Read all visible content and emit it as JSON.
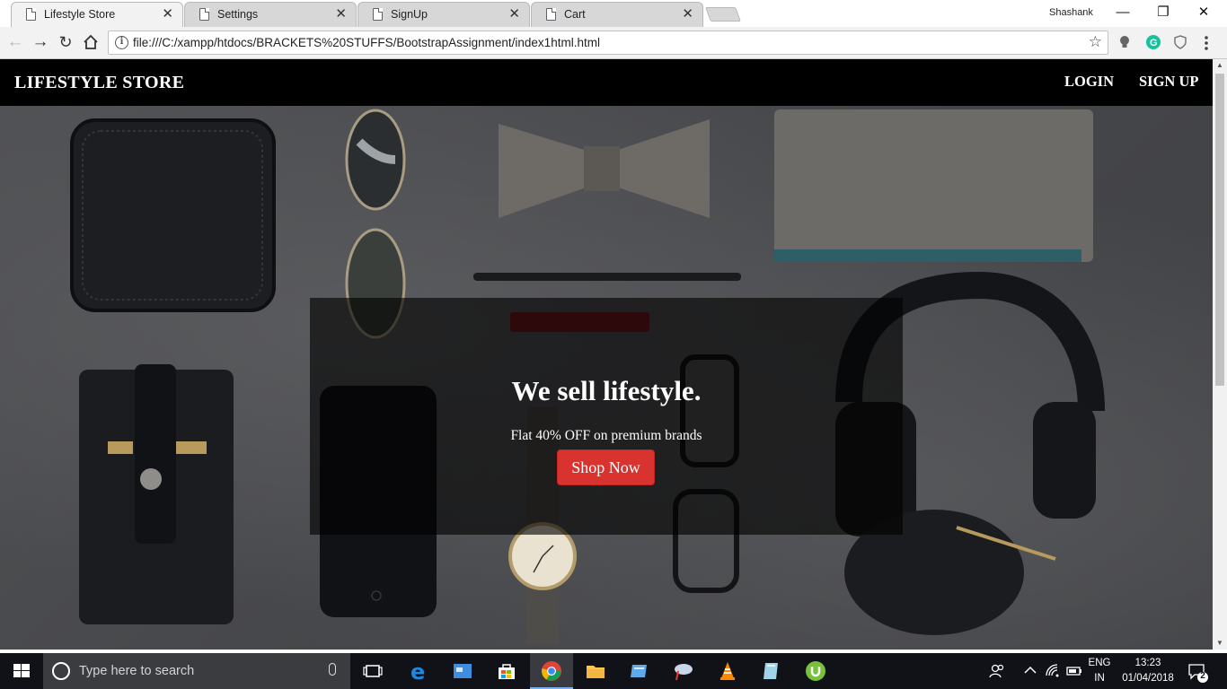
{
  "browser": {
    "tabs": [
      {
        "title": "Lifestyle Store",
        "active": true
      },
      {
        "title": "Settings",
        "active": false
      },
      {
        "title": "SignUp",
        "active": false
      },
      {
        "title": "Cart",
        "active": false
      }
    ],
    "tab_close_glyph": "✕",
    "profile": "Shashank",
    "url": "file:///C:/xampp/htdocs/BRACKETS%20STUFFS/BootstrapAssignment/index1html.html",
    "window_controls": {
      "minimize": "—",
      "restore": "❐",
      "close": "✕"
    }
  },
  "site": {
    "brand": "LIFESTYLE STORE",
    "nav": {
      "login": "LOGIN",
      "signup": "SIGN UP"
    },
    "hero": {
      "title": "We sell lifestyle.",
      "subtitle": "Flat 40% OFF on premium brands",
      "button": "Shop Now"
    }
  },
  "taskbar": {
    "search_placeholder": "Type here to search",
    "language": "ENG",
    "region": "IN",
    "time": "13:23",
    "date": "01/04/2018",
    "notifications": "2"
  },
  "colors": {
    "navbar": "#000000",
    "cta": "#d9332f",
    "overlay": "rgba(0,0,0,0.62)",
    "taskbar": "#101218"
  },
  "icons": [
    "file-icon",
    "back-icon",
    "forward-icon",
    "reload-icon",
    "home-icon",
    "info-icon",
    "bookmark-star-icon",
    "bulb-extension-icon",
    "grammarly-icon",
    "shield-extension-icon",
    "menu-icon",
    "windows-start-icon",
    "cortana-icon",
    "microphone-icon",
    "task-view-icon",
    "edge-icon",
    "store-icon",
    "chrome-icon",
    "file-explorer-icon",
    "vlc-icon",
    "utorrent-icon",
    "people-icon",
    "wifi-icon",
    "battery-icon",
    "action-center-icon"
  ]
}
